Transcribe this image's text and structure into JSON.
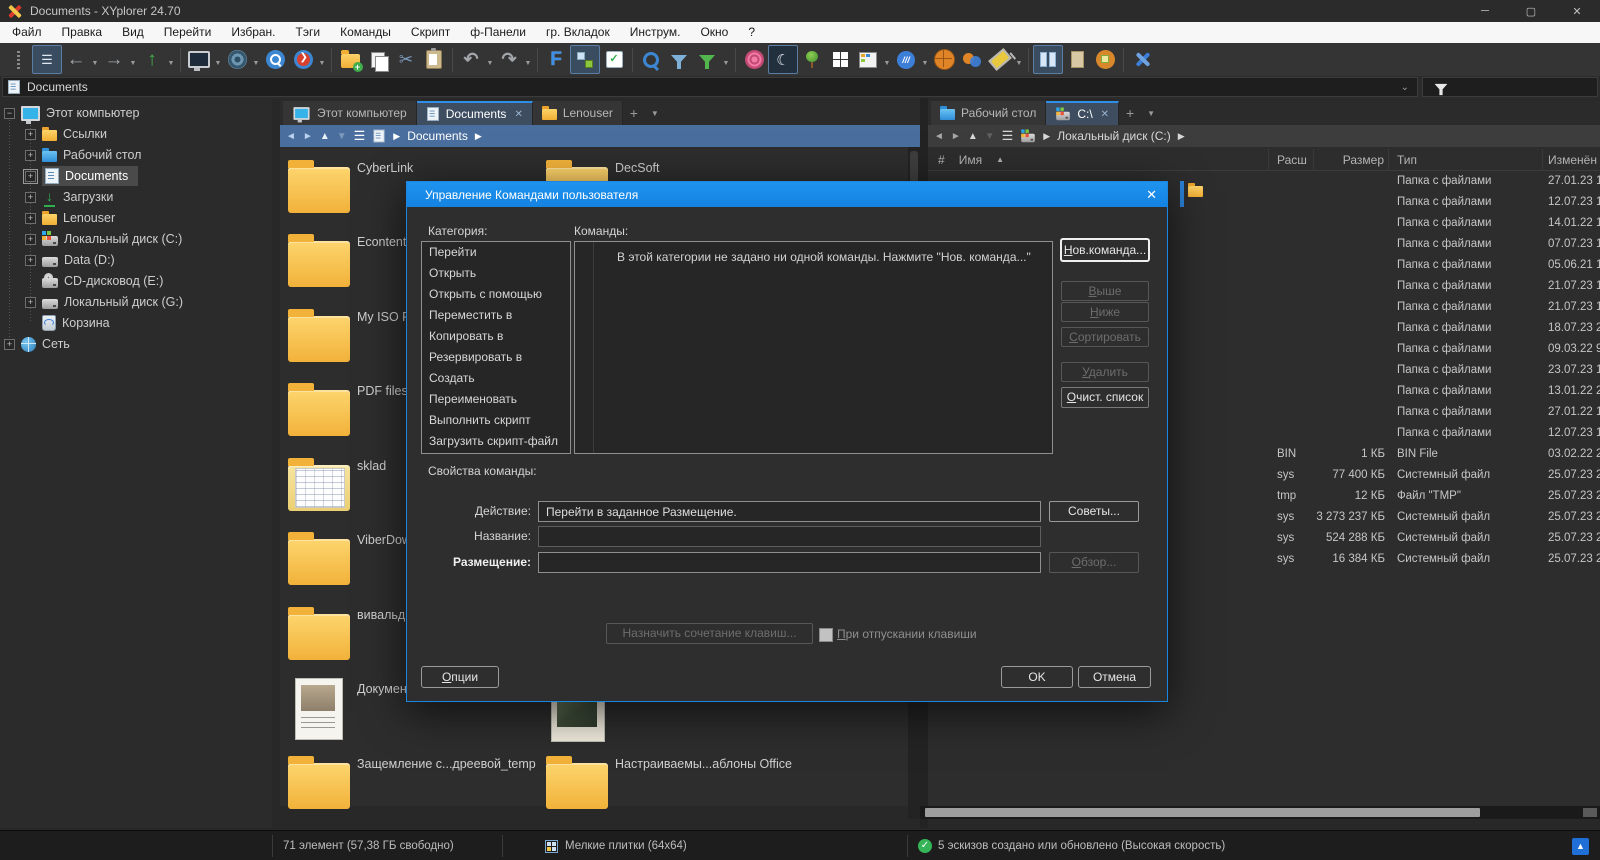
{
  "window": {
    "title": "Documents - XYplorer 24.70"
  },
  "menu": {
    "items": [
      "Файл",
      "Правка",
      "Вид",
      "Перейти",
      "Избран.",
      "Тэги",
      "Команды",
      "Скрипт",
      "ф-Панели",
      "гр. Вкладок",
      "Инструм.",
      "Окно",
      "?"
    ]
  },
  "address_bar": {
    "value": "Documents"
  },
  "tree": {
    "items": [
      "Этот компьютер",
      "Ссылки",
      "Рабочий стол",
      "Documents",
      "Загрузки",
      "Lenouser",
      "Локальный диск (C:)",
      "Data (D:)",
      "CD-дисковод (E:)",
      "Локальный диск (G:)",
      "Корзина",
      "Сеть"
    ]
  },
  "left_pane": {
    "tabs": [
      "Этот компьютер",
      "Documents",
      "Lenouser"
    ],
    "breadcrumb": {
      "path": "Documents"
    },
    "tiles": [
      "CyberLink",
      "DecSoft",
      "Econtent",
      "My ISO F",
      "PDF files",
      "sklad",
      "ViberDow",
      "вивальди",
      "Докумен",
      "Защемление с...дреевой_temp",
      "Настраиваемы...аблоны Office"
    ]
  },
  "right_pane": {
    "tabs": [
      "Рабочий стол",
      "C:\\"
    ],
    "breadcrumb": {
      "path": "Локальный диск (C:)"
    },
    "columns": [
      "#",
      "Имя",
      "Расш",
      "Размер",
      "Тип",
      "Изменён"
    ],
    "rows": [
      {
        "ext": "",
        "size": "",
        "type": "Папка с файлами",
        "modified": "27.01.23 1"
      },
      {
        "ext": "",
        "size": "",
        "type": "Папка с файлами",
        "modified": "12.07.23 1"
      },
      {
        "ext": "",
        "size": "",
        "type": "Папка с файлами",
        "modified": "14.01.22 1"
      },
      {
        "ext": "",
        "size": "",
        "type": "Папка с файлами",
        "modified": "07.07.23 1"
      },
      {
        "ext": "",
        "size": "",
        "type": "Папка с файлами",
        "modified": "05.06.21 1"
      },
      {
        "ext": "",
        "size": "",
        "type": "Папка с файлами",
        "modified": "21.07.23 1"
      },
      {
        "ext": "",
        "size": "",
        "type": "Папка с файлами",
        "modified": "21.07.23 1"
      },
      {
        "ext": "",
        "size": "",
        "type": "Папка с файлами",
        "modified": "18.07.23 2"
      },
      {
        "ext": "",
        "size": "",
        "type": "Папка с файлами",
        "modified": "09.03.22 9"
      },
      {
        "ext": "",
        "size": "",
        "type": "Папка с файлами",
        "modified": "23.07.23 1"
      },
      {
        "ext": "",
        "size": "",
        "type": "Папка с файлами",
        "modified": "13.01.22 2"
      },
      {
        "ext": "",
        "size": "",
        "type": "Папка с файлами",
        "modified": "27.01.22 1"
      },
      {
        "ext": "",
        "size": "",
        "type": "Папка с файлами",
        "modified": "12.07.23 1"
      },
      {
        "ext": "BIN",
        "size": "1 КБ",
        "type": "BIN File",
        "modified": "03.02.22 2"
      },
      {
        "ext": "sys",
        "size": "77 400 КБ",
        "type": "Системный файл",
        "modified": "25.07.23 2"
      },
      {
        "ext": "tmp",
        "size": "12 КБ",
        "type": "Файл \"TMP\"",
        "modified": "25.07.23 2"
      },
      {
        "ext": "sys",
        "size": "3 273 237 КБ",
        "type": "Системный файл",
        "modified": "25.07.23 2"
      },
      {
        "ext": "sys",
        "size": "524 288 КБ",
        "type": "Системный файл",
        "modified": "25.07.23 2"
      },
      {
        "ext": "sys",
        "size": "16 384 КБ",
        "type": "Системный файл",
        "modified": "25.07.23 2"
      }
    ]
  },
  "dialog": {
    "title": "Управление Командами пользователя",
    "category_label": "Категория:",
    "commands_label": "Команды:",
    "categories": [
      "Перейти",
      "Открыть",
      "Открыть с помощью",
      "Переместить в",
      "Копировать в",
      "Резервировать в",
      "Создать",
      "Переименовать",
      "Выполнить скрипт",
      "Загрузить скрипт-файл"
    ],
    "empty_message": "В этой категории не задано ни одной команды. Нажмите \"Нов. команда...\"",
    "properties_label": "Свойства команды:",
    "fields": {
      "action_label": "Действие:",
      "action_value": "Перейти в заданное Размещение.",
      "name_label": "Название:",
      "name_value": "",
      "location_label": "Размещение:",
      "location_value": ""
    },
    "buttons": {
      "new": "Нов.команда...",
      "up": "Выше",
      "down": "Ниже",
      "sort": "Сортировать",
      "delete": "Удалить",
      "clear": "Очист. список",
      "tips": "Советы...",
      "browse": "Обзор...",
      "assign": "Назначить сочетание клавиш...",
      "options": "Опции",
      "ok": "OK",
      "cancel": "Отмена"
    },
    "checkbox_label": "При отпускании клавиши"
  },
  "status_bar": {
    "items_count": "71 элемент (57,38 ГБ свободно)",
    "view_mode": "Мелкие плитки (64x64)",
    "thumbs_message": "5 эскизов  создано или обновлено (Высокая скорость)"
  }
}
